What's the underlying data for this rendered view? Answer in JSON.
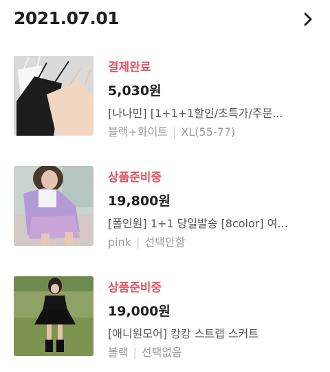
{
  "header": {
    "date": "2021.07.01",
    "more_icon": "chevron-right-icon"
  },
  "orders": [
    {
      "status": "결제완료",
      "price": "5,030원",
      "name": "[나나민] [1+1+1할인/초특가/주문...",
      "option_color": "블랙+화이트",
      "option_size": "XL(55-77)",
      "image": "camisole-tops-photo"
    },
    {
      "status": "상품준비중",
      "price": "19,800원",
      "name": "[폴인원] 1+1 당일발송 [8color] 여...",
      "option_color": "pink",
      "option_size": "선택안함",
      "image": "lavender-cardigan-photo"
    },
    {
      "status": "상품준비중",
      "price": "19,000원",
      "name": "[애니원모어] 캉캉 스트랩 스커트",
      "option_color": "블랙",
      "option_size": "선택없음",
      "image": "black-skirt-photo"
    }
  ],
  "colors": {
    "status": "#e05561",
    "text": "#1f1f1f",
    "muted": "#9a9a9a"
  }
}
